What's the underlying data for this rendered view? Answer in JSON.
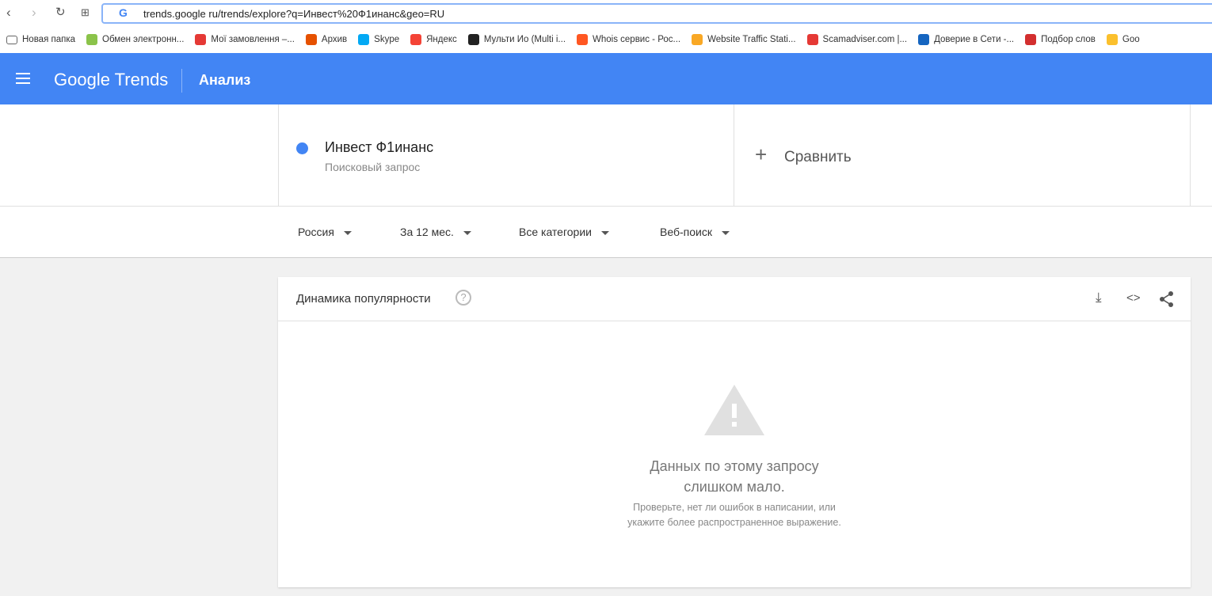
{
  "browser": {
    "url": "trends.google ru/trends/explore?q=Инвест%20Ф1инанс&geo=RU",
    "bookmarks": [
      {
        "label": "Новая папка",
        "color": "#666"
      },
      {
        "label": "Обмен электронн...",
        "color": "#8bc34a"
      },
      {
        "label": "Мої замовлення –...",
        "color": "#e53935"
      },
      {
        "label": "Архив",
        "color": "#e65100"
      },
      {
        "label": "Skype",
        "color": "#03a9f4"
      },
      {
        "label": "Яндекс",
        "color": "#f44336"
      },
      {
        "label": "Мульти Ио (Multi i...",
        "color": "#222"
      },
      {
        "label": "Whois сервис - Рос...",
        "color": "#ff5722"
      },
      {
        "label": "Website Traffic Stati...",
        "color": "#f9a825"
      },
      {
        "label": "Scamadviser.com |...",
        "color": "#e53935"
      },
      {
        "label": "Доверие в Сети -...",
        "color": "#1565c0"
      },
      {
        "label": "Подбор слов",
        "color": "#d32f2f"
      },
      {
        "label": "Goo",
        "color": "#fbc02d"
      }
    ]
  },
  "header": {
    "logo": "Google Trends",
    "title": "Анализ"
  },
  "term": {
    "name": "Инвест Ф1инанс",
    "type": "Поисковый запрос",
    "color": "#4285f4"
  },
  "compare": {
    "plus": "+",
    "label": "Сравнить"
  },
  "filters": [
    "Россия",
    "За 12 мес.",
    "Все категории",
    "Веб-поиск"
  ],
  "card": {
    "title": "Динамика популярности",
    "help": "?",
    "line1": "Данных по этому запросу",
    "line2": "слишком мало.",
    "hint1": "Проверьте, нет ли ошибок в написании, или",
    "hint2": "укажите более распространенное выражение."
  }
}
